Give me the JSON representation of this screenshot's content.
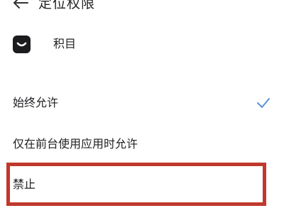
{
  "header": {
    "title": "定位权限"
  },
  "app": {
    "name": "积目",
    "icon": "jimu-app-icon"
  },
  "options": [
    {
      "label": "始终允许",
      "selected": true
    },
    {
      "label": "仅在前台使用应用时允许",
      "selected": false
    },
    {
      "label": "禁止",
      "selected": false
    }
  ],
  "colors": {
    "accent": "#5b8fd8",
    "highlight": "#c0382c"
  }
}
